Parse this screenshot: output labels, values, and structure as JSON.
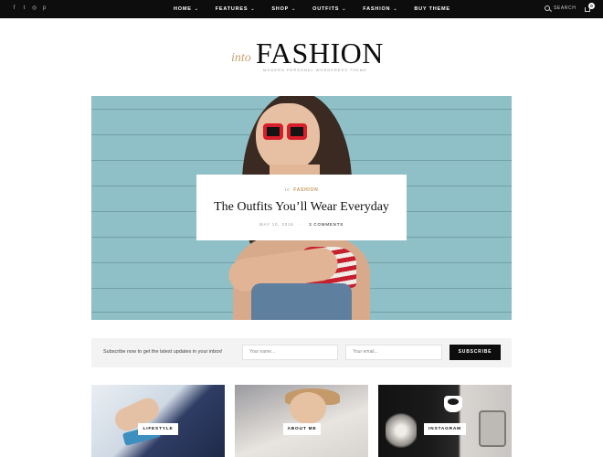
{
  "topbar": {
    "social_icons": [
      "facebook-icon",
      "twitter-icon",
      "instagram-icon",
      "pinterest-icon"
    ],
    "social_glyphs": [
      "f",
      "t",
      "◎",
      "p"
    ],
    "nav": [
      {
        "label": "HOME",
        "has_dropdown": true
      },
      {
        "label": "FEATURES",
        "has_dropdown": true
      },
      {
        "label": "SHOP",
        "has_dropdown": true
      },
      {
        "label": "OUTFITS",
        "has_dropdown": true
      },
      {
        "label": "FASHION",
        "has_dropdown": true
      },
      {
        "label": "BUY THEME",
        "has_dropdown": false
      }
    ],
    "search_label": "SEARCH",
    "cart_count": "0"
  },
  "logo": {
    "prefix": "into",
    "name": "FASHION",
    "tagline": "MODERN PERSONAL WORDPRESS THEME"
  },
  "hero": {
    "category_prefix": "In",
    "category": "FASHION",
    "title": "The Outfits You’ll Wear Everyday",
    "date": "MAY 10, 2016",
    "comments": "3 COMMENTS"
  },
  "subscribe": {
    "text": "Subscribe now to get the latest updates in your inbox!",
    "name_placeholder": "Your name...",
    "email_placeholder": "Your email...",
    "button_label": "SUBSCRIBE"
  },
  "promos": [
    {
      "label": "LIFESTYLE"
    },
    {
      "label": "ABOUT ME"
    },
    {
      "label": "INSTAGRAM"
    }
  ],
  "colors": {
    "topbar_bg": "#0d0d0d",
    "accent_gold": "#c49a5c",
    "subscribe_bg": "#f3f3f3"
  }
}
